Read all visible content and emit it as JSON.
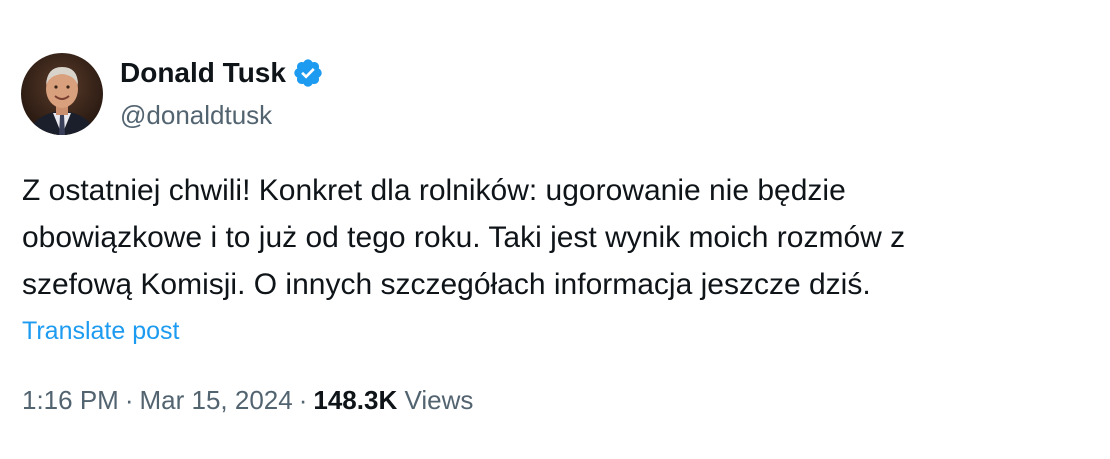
{
  "author": {
    "display_name": "Donald Tusk",
    "handle": "@donaldtusk",
    "verified": true,
    "avatar_icon": "profile-photo",
    "verified_icon": "verified-badge-icon",
    "verified_color": "#1d9bf0"
  },
  "post": {
    "lines": [
      "Z ostatniej chwili! Konkret dla rolników: ugorowanie nie będzie",
      "obowiązkowe i to już od tego roku. Taki jest wynik moich rozmów z",
      "szefową Komisji. O innych szczegółach informacja jeszcze dziś."
    ],
    "translate_label": "Translate post"
  },
  "meta": {
    "time": "1:16 PM",
    "separator": "·",
    "date": "Mar 15, 2024",
    "views_count": "148.3K",
    "views_label": "Views"
  },
  "colors": {
    "text": "#0f1419",
    "secondary": "#536471",
    "link": "#1d9bf0"
  }
}
